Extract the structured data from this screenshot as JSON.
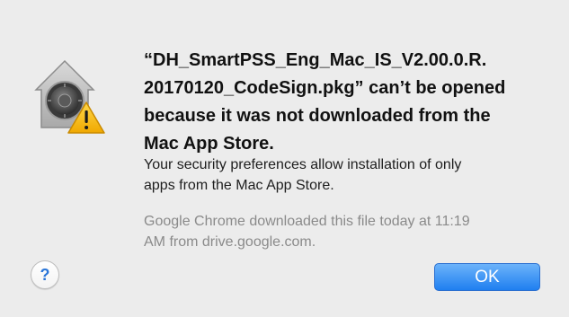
{
  "dialog": {
    "title": "“DH_SmartPSS_Eng_Mac_IS_V2.00.0.R.\n20170120_CodeSign.pkg” can’t be opened\nbecause it was not downloaded from the\nMac App Store.",
    "info": "Your security preferences allow installation of only\napps from the Mac App Store.",
    "source": "Google Chrome downloaded this file today at 11:19\nAM from drive.google.com.",
    "icon": "gatekeeper-lock-warning-icon",
    "help_label": "?",
    "ok_label": "OK"
  },
  "colors": {
    "background": "#ececec",
    "ok_button": "#2b86f2",
    "help_question": "#2a75d8",
    "warning": "#f7c21a"
  }
}
